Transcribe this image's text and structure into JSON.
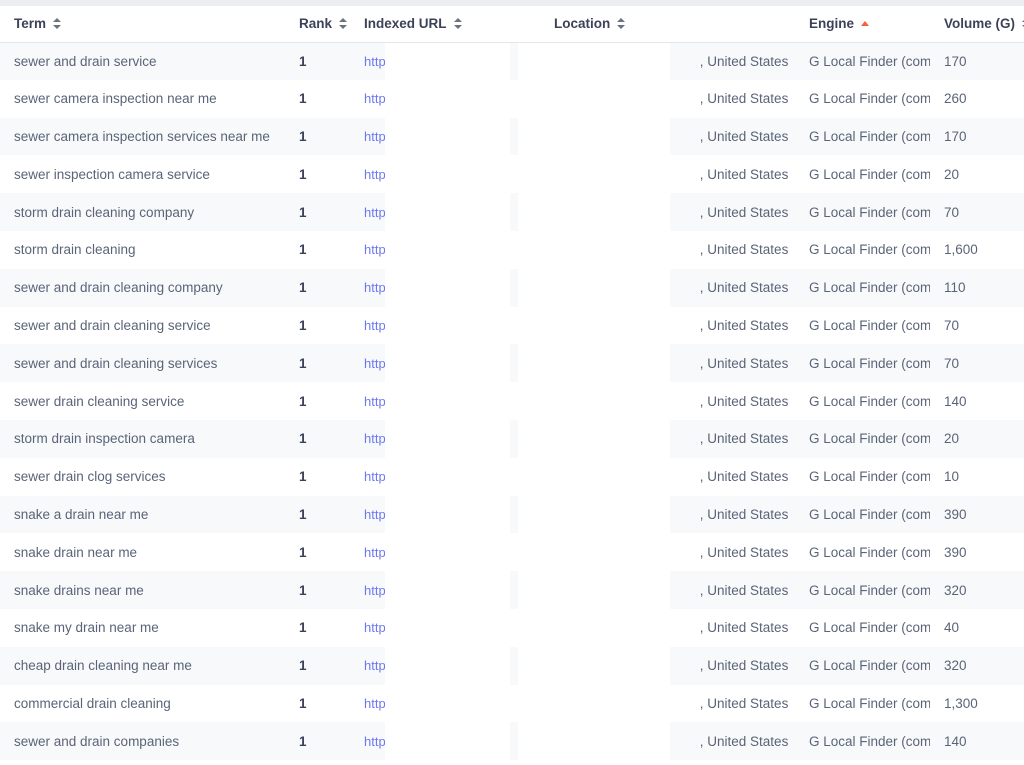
{
  "table": {
    "columns": [
      {
        "key": "term",
        "label": "Term",
        "sort": "none"
      },
      {
        "key": "rank",
        "label": "Rank",
        "sort": "none"
      },
      {
        "key": "url",
        "label": "Indexed URL",
        "sort": "none"
      },
      {
        "key": "location",
        "label": "Location",
        "sort": "none"
      },
      {
        "key": "engine",
        "label": "Engine",
        "sort": "asc"
      },
      {
        "key": "volume",
        "label": "Volume (G)",
        "sort": "none"
      }
    ],
    "url_prefix": "https:/",
    "url_suffix": "/",
    "location_suffix": ", United States",
    "rows": [
      {
        "term": "sewer and drain service",
        "rank": "1",
        "url_prefix": "https:/",
        "url_suffix": "/",
        "location": ", United States",
        "engine": "G Local Finder (com)",
        "volume": "170"
      },
      {
        "term": "sewer camera inspection near me",
        "rank": "1",
        "url_prefix": "https:/",
        "url_suffix": "/",
        "location": ", United States",
        "engine": "G Local Finder (com)",
        "volume": "260"
      },
      {
        "term": "sewer camera inspection services near me",
        "rank": "1",
        "url_prefix": "https:/",
        "url_suffix": "/",
        "location": ", United States",
        "engine": "G Local Finder (com)",
        "volume": "170"
      },
      {
        "term": "sewer inspection camera service",
        "rank": "1",
        "url_prefix": "https:/",
        "url_suffix": "/",
        "location": ", United States",
        "engine": "G Local Finder (com)",
        "volume": "20"
      },
      {
        "term": "storm drain cleaning company",
        "rank": "1",
        "url_prefix": "https:/",
        "url_suffix": "/",
        "location": ", United States",
        "engine": "G Local Finder (com)",
        "volume": "70"
      },
      {
        "term": "storm drain cleaning",
        "rank": "1",
        "url_prefix": "https:/",
        "url_suffix": "/",
        "location": ", United States",
        "engine": "G Local Finder (com)",
        "volume": "1,600"
      },
      {
        "term": "sewer and drain cleaning company",
        "rank": "1",
        "url_prefix": "https:/",
        "url_suffix": "/",
        "location": ", United States",
        "engine": "G Local Finder (com)",
        "volume": "110"
      },
      {
        "term": "sewer and drain cleaning service",
        "rank": "1",
        "url_prefix": "https:/",
        "url_suffix": "/",
        "location": ", United States",
        "engine": "G Local Finder (com)",
        "volume": "70"
      },
      {
        "term": "sewer and drain cleaning services",
        "rank": "1",
        "url_prefix": "https:/",
        "url_suffix": "/",
        "location": ", United States",
        "engine": "G Local Finder (com)",
        "volume": "70"
      },
      {
        "term": "sewer drain cleaning service",
        "rank": "1",
        "url_prefix": "https:/",
        "url_suffix": "/",
        "location": ", United States",
        "engine": "G Local Finder (com)",
        "volume": "140"
      },
      {
        "term": "storm drain inspection camera",
        "rank": "1",
        "url_prefix": "https:/",
        "url_suffix": "/",
        "location": ", United States",
        "engine": "G Local Finder (com)",
        "volume": "20"
      },
      {
        "term": "sewer drain clog services",
        "rank": "1",
        "url_prefix": "https:/",
        "url_suffix": "/",
        "location": ", United States",
        "engine": "G Local Finder (com)",
        "volume": "10"
      },
      {
        "term": "snake a drain near me",
        "rank": "1",
        "url_prefix": "https:/",
        "url_suffix": "/",
        "location": ", United States",
        "engine": "G Local Finder (com)",
        "volume": "390"
      },
      {
        "term": "snake drain near me",
        "rank": "1",
        "url_prefix": "https:/",
        "url_suffix": "/",
        "location": ", United States",
        "engine": "G Local Finder (com)",
        "volume": "390"
      },
      {
        "term": "snake drains near me",
        "rank": "1",
        "url_prefix": "https:/",
        "url_suffix": "/",
        "location": ", United States",
        "engine": "G Local Finder (com)",
        "volume": "320"
      },
      {
        "term": "snake my drain near me",
        "rank": "1",
        "url_prefix": "https:/",
        "url_suffix": "/",
        "location": ", United States",
        "engine": "G Local Finder (com)",
        "volume": "40"
      },
      {
        "term": "cheap drain cleaning near me",
        "rank": "1",
        "url_prefix": "https:/",
        "url_suffix": "/",
        "location": ", United States",
        "engine": "G Local Finder (com)",
        "volume": "320"
      },
      {
        "term": "commercial drain cleaning",
        "rank": "1",
        "url_prefix": "https:/",
        "url_suffix": "/",
        "location": ", United States",
        "engine": "G Local Finder (com)",
        "volume": "1,300"
      },
      {
        "term": "sewer and drain companies",
        "rank": "1",
        "url_prefix": "https:/",
        "url_suffix": "/",
        "location": ", United States",
        "engine": "G Local Finder (com)",
        "volume": "140"
      }
    ]
  },
  "colors": {
    "active_sort": "#f4623a",
    "link": "#6b79f0",
    "header_text": "#3c4257",
    "body_text": "#5a6478",
    "stripe": "#f8f9fb",
    "border": "#e4e7ec"
  }
}
